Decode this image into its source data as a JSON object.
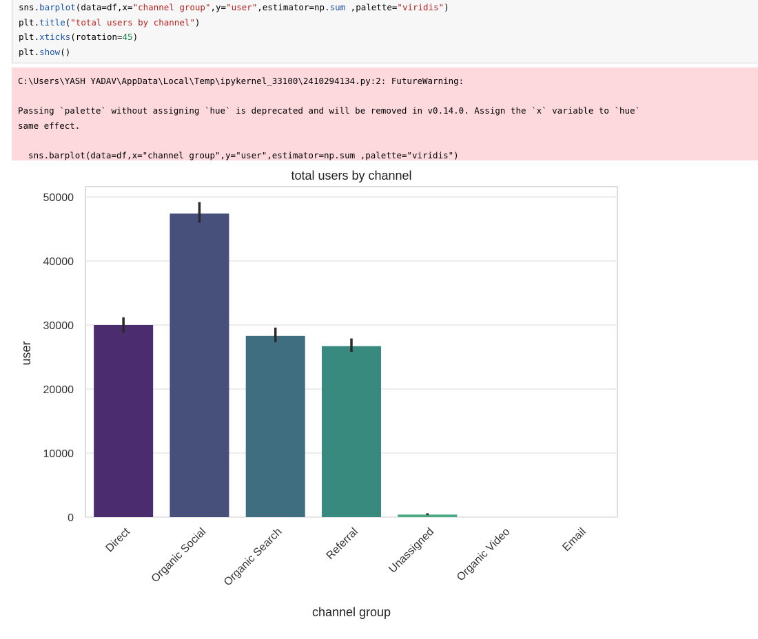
{
  "code_cell": {
    "lines": [
      [
        {
          "t": "sns."
        },
        {
          "t": "barplot",
          "c": "fn"
        },
        {
          "t": "(data=df,x="
        },
        {
          "t": "\"channel group\"",
          "c": "str"
        },
        {
          "t": ",y="
        },
        {
          "t": "\"user\"",
          "c": "str"
        },
        {
          "t": ",estimator=np."
        },
        {
          "t": "sum",
          "c": "fn"
        },
        {
          "t": " ,palette="
        },
        {
          "t": "\"viridis\"",
          "c": "str"
        },
        {
          "t": ")"
        }
      ],
      [
        {
          "t": "plt."
        },
        {
          "t": "title",
          "c": "fn"
        },
        {
          "t": "("
        },
        {
          "t": "\"total users by channel\"",
          "c": "str"
        },
        {
          "t": ")"
        }
      ],
      [
        {
          "t": "plt."
        },
        {
          "t": "xticks",
          "c": "fn"
        },
        {
          "t": "(rotation="
        },
        {
          "t": "45",
          "c": "num"
        },
        {
          "t": ")"
        }
      ],
      [
        {
          "t": "plt."
        },
        {
          "t": "show",
          "c": "fn"
        },
        {
          "t": "()"
        }
      ]
    ]
  },
  "warning": {
    "line1": "C:\\Users\\YASH YADAV\\AppData\\Local\\Temp\\ipykernel_33100\\2410294134.py:2: FutureWarning:",
    "line2": "Passing `palette` without assigning `hue` is deprecated and will be removed in v0.14.0. Assign the `x` variable to `hue`",
    "line3": "same effect.",
    "line4": "  sns.barplot(data=df,x=\"channel group\",y=\"user\",estimator=np.sum ,palette=\"viridis\")"
  },
  "chart_data": {
    "type": "bar",
    "title": "total users by channel",
    "xlabel": "channel group",
    "ylabel": "user",
    "categories": [
      "Direct",
      "Organic Social",
      "Organic Search",
      "Referral",
      "Unassigned",
      "Organic Video",
      "Email"
    ],
    "values": [
      30000,
      47400,
      28300,
      26700,
      400,
      0,
      0
    ],
    "ci_low": [
      28800,
      46000,
      27300,
      25800,
      300,
      0,
      0
    ],
    "ci_high": [
      31200,
      49200,
      29600,
      27900,
      600,
      0,
      0
    ],
    "colors": [
      "#4b2c6f",
      "#46507b",
      "#3e6e80",
      "#388a7f",
      "#4aab84",
      "#5fbf86",
      "#7ccd80"
    ],
    "yticks": [
      0,
      10000,
      20000,
      30000,
      40000,
      50000
    ],
    "ylim": [
      0,
      52000
    ],
    "grid": true,
    "xtick_rotation": 45
  }
}
